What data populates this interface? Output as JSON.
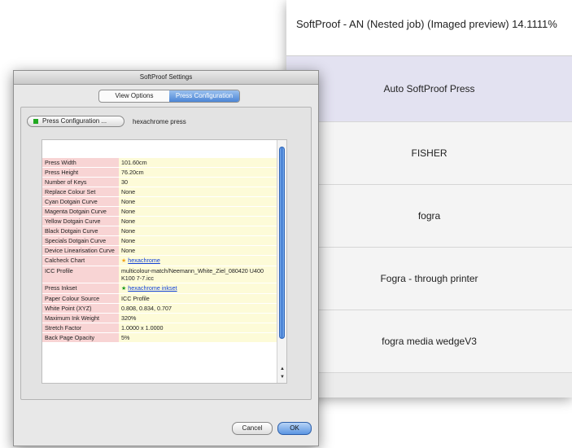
{
  "list_window": {
    "title": "SoftProof - AN (Nested job) (Imaged preview) 14.1111%",
    "items": [
      {
        "label": "Auto SoftProof Press",
        "selected": true
      },
      {
        "label": "FISHER",
        "selected": false
      },
      {
        "label": "fogra",
        "selected": false
      },
      {
        "label": "Fogra - through printer",
        "selected": false
      },
      {
        "label": "fogra media wedgeV3",
        "selected": false
      }
    ],
    "selected_color": "#e3e2f1"
  },
  "dialog": {
    "title": "SoftProof Settings",
    "tabs": [
      {
        "label": "View Options",
        "active": false
      },
      {
        "label": "Press Configuration",
        "active": true
      }
    ],
    "press_button_label": "Press Configuration ...",
    "press_name": "hexachrome press",
    "properties": [
      {
        "key": "Press Width",
        "value": "101.60cm"
      },
      {
        "key": "Press Height",
        "value": "76.20cm"
      },
      {
        "key": "Number of Keys",
        "value": "30"
      },
      {
        "key": "Replace Colour Set",
        "value": "None"
      },
      {
        "key": "Cyan Dotgain Curve",
        "value": "None"
      },
      {
        "key": "Magenta Dotgain Curve",
        "value": "None"
      },
      {
        "key": "Yellow Dotgain Curve",
        "value": "None"
      },
      {
        "key": "Black Dotgain Curve",
        "value": "None"
      },
      {
        "key": "Specials Dotgain Curve",
        "value": "None"
      },
      {
        "key": "Device Linearisation Curve",
        "value": "None"
      },
      {
        "key": "Calcheck Chart",
        "value": "hexachrome",
        "link": true,
        "star": "orange-star-icon"
      },
      {
        "key": "ICC Profile",
        "value": "multicolour-match/Neemann_White_Ziel_080420 U400 K100 7-7.icc"
      },
      {
        "key": "Press Inkset",
        "value": "hexachrome inkset",
        "link": true,
        "star": "green-star-icon"
      },
      {
        "key": "Paper Colour Source",
        "value": "ICC Profile"
      },
      {
        "key": "White Point (XYZ)",
        "value": "0.808, 0.834, 0.707"
      },
      {
        "key": "Maximum Ink Weight",
        "value": "320%"
      },
      {
        "key": "Stretch Factor",
        "value": "1.0000 x 1.0000"
      },
      {
        "key": "Back Page Opacity",
        "value": "5%"
      }
    ],
    "cancel_label": "Cancel",
    "ok_label": "OK",
    "colors": {
      "key_bg": "#f8d4d4",
      "value_bg": "#fdfbd8",
      "link": "#1140d8",
      "accent": "#4c86d6"
    }
  }
}
